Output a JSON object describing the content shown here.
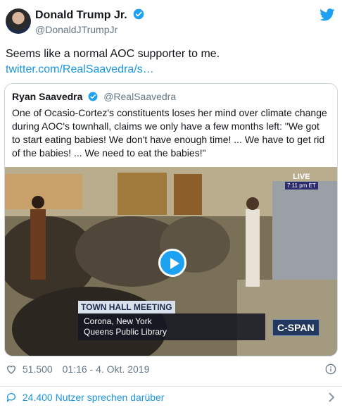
{
  "author": {
    "name": "Donald Trump Jr.",
    "handle": "@DonaldJTrumpJr"
  },
  "tweet": {
    "text": "Seems like a normal AOC supporter to me.",
    "link": "twitter.com/RealSaavedra/s…"
  },
  "quoted": {
    "name": "Ryan Saavedra",
    "handle": "@RealSaavedra",
    "text": "One of Ocasio-Cortez's constituents loses her mind over climate change during AOC's townhall, claims we only have a few months left: \"We got to start eating babies! We don't have enough time! ...  We have to get rid of the babies! ... We need to eat the babies!\""
  },
  "video": {
    "live_label": "LIVE",
    "live_time": "7:11 pm ET",
    "caption_title": "TOWN HALL MEETING",
    "caption_line1": "Corona, New York",
    "caption_line2": "Queens Public Library",
    "network": "C-SPAN"
  },
  "meta": {
    "likes": "51.500",
    "timestamp": "01:16 - 4. Okt. 2019"
  },
  "footer": {
    "replies": "24.400 Nutzer sprechen darüber"
  },
  "colors": {
    "link": "#1b95e0",
    "muted": "#657786",
    "border": "#ccd6dd"
  }
}
